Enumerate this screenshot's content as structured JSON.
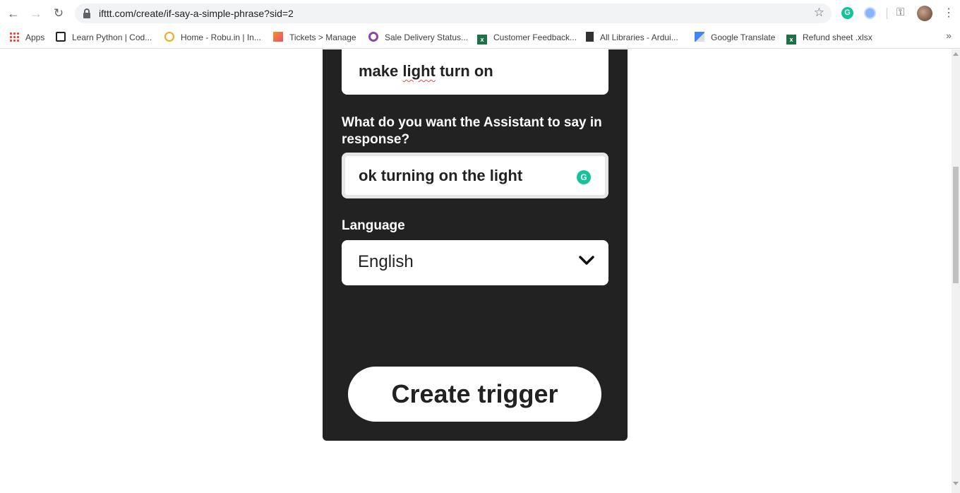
{
  "browser": {
    "url": "ifttt.com/create/if-say-a-simple-phrase?sid=2",
    "bookmarks": [
      {
        "label": "Apps",
        "icon": "apps-grid-icon"
      },
      {
        "label": "Learn Python | Cod...",
        "icon": "codecademy-icon"
      },
      {
        "label": "Home - Robu.in | In...",
        "icon": "robu-icon"
      },
      {
        "label": "Tickets > Manage",
        "icon": "kayako-icon"
      },
      {
        "label": "Sale Delivery Status...",
        "icon": "circle-icon"
      },
      {
        "label": "Customer Feedback...",
        "icon": "excel-icon"
      },
      {
        "label": "All Libraries - Ardui...",
        "icon": "book-icon"
      },
      {
        "label": "Google Translate",
        "icon": "google-translate-icon"
      },
      {
        "label": "Refund sheet .xlsx",
        "icon": "excel-icon"
      }
    ],
    "more_bookmarks": "»"
  },
  "form": {
    "phrase_value": "make",
    "phrase_value_misspelled": "light",
    "phrase_value_rest": "turn on",
    "response_label": "What do you want the Assistant to say in response?",
    "response_value": "ok turning on the light",
    "language_label": "Language",
    "language_value": "English",
    "create_button": "Create trigger"
  },
  "colors": {
    "card_bg": "#222222",
    "grammarly": "#15c39a"
  }
}
